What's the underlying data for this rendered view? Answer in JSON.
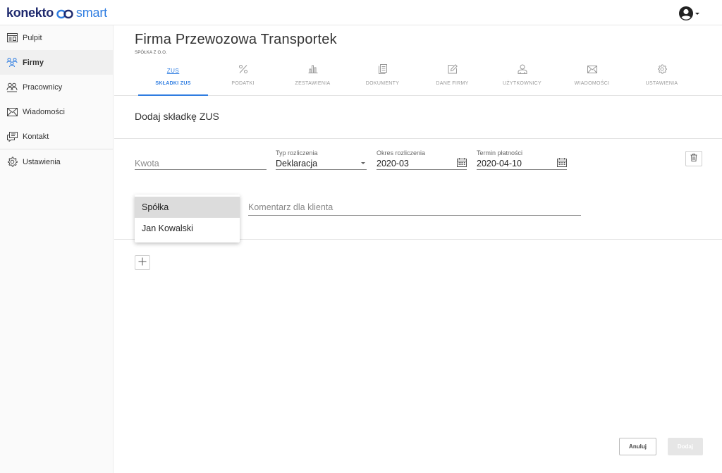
{
  "brand": {
    "part1": "konekto",
    "part2": "smart",
    "color_dark": "#1f2a6e",
    "color_accent": "#2f7de1"
  },
  "user": {
    "icon": "account-circle-icon"
  },
  "sidebar": {
    "items": [
      {
        "label": "Pulpit",
        "icon": "dashboard-icon"
      },
      {
        "label": "Firmy",
        "icon": "companies-icon",
        "active": true
      },
      {
        "label": "Pracownicy",
        "icon": "employees-icon"
      },
      {
        "label": "Wiadomości",
        "icon": "mail-icon"
      },
      {
        "label": "Kontakt",
        "icon": "contact-icon"
      },
      {
        "label": "Ustawienia",
        "icon": "gear-icon"
      }
    ]
  },
  "company": {
    "name": "Firma Przewozowa Transportek",
    "type": "SPÓŁKA Z O.O."
  },
  "tabs": [
    {
      "label": "SKŁADKI ZUS",
      "icon_text": "ZUS",
      "active": true
    },
    {
      "label": "PODATKI",
      "icon": "percent-icon"
    },
    {
      "label": "ZESTAWIENIA",
      "icon": "bar-chart-icon"
    },
    {
      "label": "DOKUMENTY",
      "icon": "documents-icon"
    },
    {
      "label": "DANE FIRMY",
      "icon": "edit-icon"
    },
    {
      "label": "UŻYTKOWNICY",
      "icon": "users-icon"
    },
    {
      "label": "WIADOMOŚCI",
      "icon": "mail-icon"
    },
    {
      "label": "USTAWIENIA",
      "icon": "gear-icon"
    }
  ],
  "form": {
    "title": "Dodaj składkę ZUS",
    "kwota": {
      "placeholder": "Kwota",
      "value": ""
    },
    "typ": {
      "label": "Typ rozliczenia",
      "value": "Deklaracja"
    },
    "okres": {
      "label": "Okres rozliczenia",
      "value": "2020-03"
    },
    "termin": {
      "label": "Termin płatności",
      "value": "2020-04-10"
    },
    "comment": {
      "placeholder": "Komentarz dla klienta"
    },
    "dropdown_options": [
      "Spółka",
      "Jan Kowalski"
    ],
    "dropdown_selected": "Spółka"
  },
  "buttons": {
    "cancel": "Anuluj",
    "submit": "Dodaj"
  }
}
